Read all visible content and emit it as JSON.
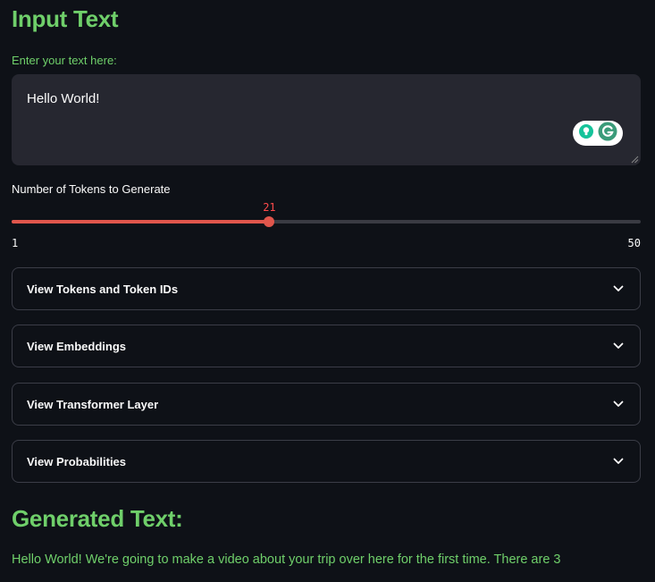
{
  "input": {
    "heading": "Input Text",
    "label": "Enter your text here:",
    "value": "Hello World!"
  },
  "slider": {
    "label": "Number of Tokens to Generate",
    "min": 1,
    "max": 50,
    "value": 21,
    "min_label": "1",
    "max_label": "50",
    "value_label": "21"
  },
  "expanders": [
    {
      "label": "View Tokens and Token IDs"
    },
    {
      "label": "View Embeddings"
    },
    {
      "label": "View Transformer Layer"
    },
    {
      "label": "View Probabilities"
    }
  ],
  "output": {
    "heading": "Generated Text:",
    "text": "Hello World! We're going to make a video about your trip over here for the first time. There are 3"
  },
  "colors": {
    "accent_green": "#6fcf6a",
    "slider_red": "#e0564c",
    "background": "#0e1117",
    "input_bg": "#262730"
  },
  "icons": {
    "expander": "chevron-down-icon",
    "grammarly": "grammarly-icon",
    "lightbulb": "lightbulb-icon"
  }
}
